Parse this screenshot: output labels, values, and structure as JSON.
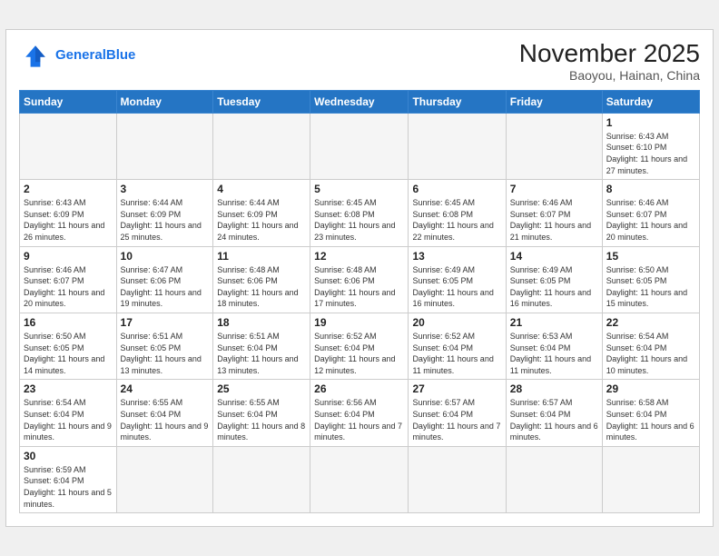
{
  "header": {
    "logo_general": "General",
    "logo_blue": "Blue",
    "month_title": "November 2025",
    "location": "Baoyou, Hainan, China"
  },
  "weekdays": [
    "Sunday",
    "Monday",
    "Tuesday",
    "Wednesday",
    "Thursday",
    "Friday",
    "Saturday"
  ],
  "weeks": [
    [
      {
        "day": "",
        "empty": true
      },
      {
        "day": "",
        "empty": true
      },
      {
        "day": "",
        "empty": true
      },
      {
        "day": "",
        "empty": true
      },
      {
        "day": "",
        "empty": true
      },
      {
        "day": "",
        "empty": true
      },
      {
        "day": "1",
        "sunrise": "6:43 AM",
        "sunset": "6:10 PM",
        "daylight": "11 hours and 27 minutes."
      }
    ],
    [
      {
        "day": "2",
        "sunrise": "6:43 AM",
        "sunset": "6:09 PM",
        "daylight": "11 hours and 26 minutes."
      },
      {
        "day": "3",
        "sunrise": "6:44 AM",
        "sunset": "6:09 PM",
        "daylight": "11 hours and 25 minutes."
      },
      {
        "day": "4",
        "sunrise": "6:44 AM",
        "sunset": "6:09 PM",
        "daylight": "11 hours and 24 minutes."
      },
      {
        "day": "5",
        "sunrise": "6:45 AM",
        "sunset": "6:08 PM",
        "daylight": "11 hours and 23 minutes."
      },
      {
        "day": "6",
        "sunrise": "6:45 AM",
        "sunset": "6:08 PM",
        "daylight": "11 hours and 22 minutes."
      },
      {
        "day": "7",
        "sunrise": "6:46 AM",
        "sunset": "6:07 PM",
        "daylight": "11 hours and 21 minutes."
      },
      {
        "day": "8",
        "sunrise": "6:46 AM",
        "sunset": "6:07 PM",
        "daylight": "11 hours and 20 minutes."
      }
    ],
    [
      {
        "day": "9",
        "sunrise": "6:46 AM",
        "sunset": "6:07 PM",
        "daylight": "11 hours and 20 minutes."
      },
      {
        "day": "10",
        "sunrise": "6:47 AM",
        "sunset": "6:06 PM",
        "daylight": "11 hours and 19 minutes."
      },
      {
        "day": "11",
        "sunrise": "6:48 AM",
        "sunset": "6:06 PM",
        "daylight": "11 hours and 18 minutes."
      },
      {
        "day": "12",
        "sunrise": "6:48 AM",
        "sunset": "6:06 PM",
        "daylight": "11 hours and 17 minutes."
      },
      {
        "day": "13",
        "sunrise": "6:49 AM",
        "sunset": "6:05 PM",
        "daylight": "11 hours and 16 minutes."
      },
      {
        "day": "14",
        "sunrise": "6:49 AM",
        "sunset": "6:05 PM",
        "daylight": "11 hours and 16 minutes."
      },
      {
        "day": "15",
        "sunrise": "6:50 AM",
        "sunset": "6:05 PM",
        "daylight": "11 hours and 15 minutes."
      }
    ],
    [
      {
        "day": "16",
        "sunrise": "6:50 AM",
        "sunset": "6:05 PM",
        "daylight": "11 hours and 14 minutes."
      },
      {
        "day": "17",
        "sunrise": "6:51 AM",
        "sunset": "6:05 PM",
        "daylight": "11 hours and 13 minutes."
      },
      {
        "day": "18",
        "sunrise": "6:51 AM",
        "sunset": "6:04 PM",
        "daylight": "11 hours and 13 minutes."
      },
      {
        "day": "19",
        "sunrise": "6:52 AM",
        "sunset": "6:04 PM",
        "daylight": "11 hours and 12 minutes."
      },
      {
        "day": "20",
        "sunrise": "6:52 AM",
        "sunset": "6:04 PM",
        "daylight": "11 hours and 11 minutes."
      },
      {
        "day": "21",
        "sunrise": "6:53 AM",
        "sunset": "6:04 PM",
        "daylight": "11 hours and 11 minutes."
      },
      {
        "day": "22",
        "sunrise": "6:54 AM",
        "sunset": "6:04 PM",
        "daylight": "11 hours and 10 minutes."
      }
    ],
    [
      {
        "day": "23",
        "sunrise": "6:54 AM",
        "sunset": "6:04 PM",
        "daylight": "11 hours and 9 minutes."
      },
      {
        "day": "24",
        "sunrise": "6:55 AM",
        "sunset": "6:04 PM",
        "daylight": "11 hours and 9 minutes."
      },
      {
        "day": "25",
        "sunrise": "6:55 AM",
        "sunset": "6:04 PM",
        "daylight": "11 hours and 8 minutes."
      },
      {
        "day": "26",
        "sunrise": "6:56 AM",
        "sunset": "6:04 PM",
        "daylight": "11 hours and 7 minutes."
      },
      {
        "day": "27",
        "sunrise": "6:57 AM",
        "sunset": "6:04 PM",
        "daylight": "11 hours and 7 minutes."
      },
      {
        "day": "28",
        "sunrise": "6:57 AM",
        "sunset": "6:04 PM",
        "daylight": "11 hours and 6 minutes."
      },
      {
        "day": "29",
        "sunrise": "6:58 AM",
        "sunset": "6:04 PM",
        "daylight": "11 hours and 6 minutes."
      }
    ],
    [
      {
        "day": "30",
        "sunrise": "6:59 AM",
        "sunset": "6:04 PM",
        "daylight": "11 hours and 5 minutes."
      },
      {
        "day": "",
        "empty": true
      },
      {
        "day": "",
        "empty": true
      },
      {
        "day": "",
        "empty": true
      },
      {
        "day": "",
        "empty": true
      },
      {
        "day": "",
        "empty": true
      },
      {
        "day": "",
        "empty": true
      }
    ]
  ]
}
